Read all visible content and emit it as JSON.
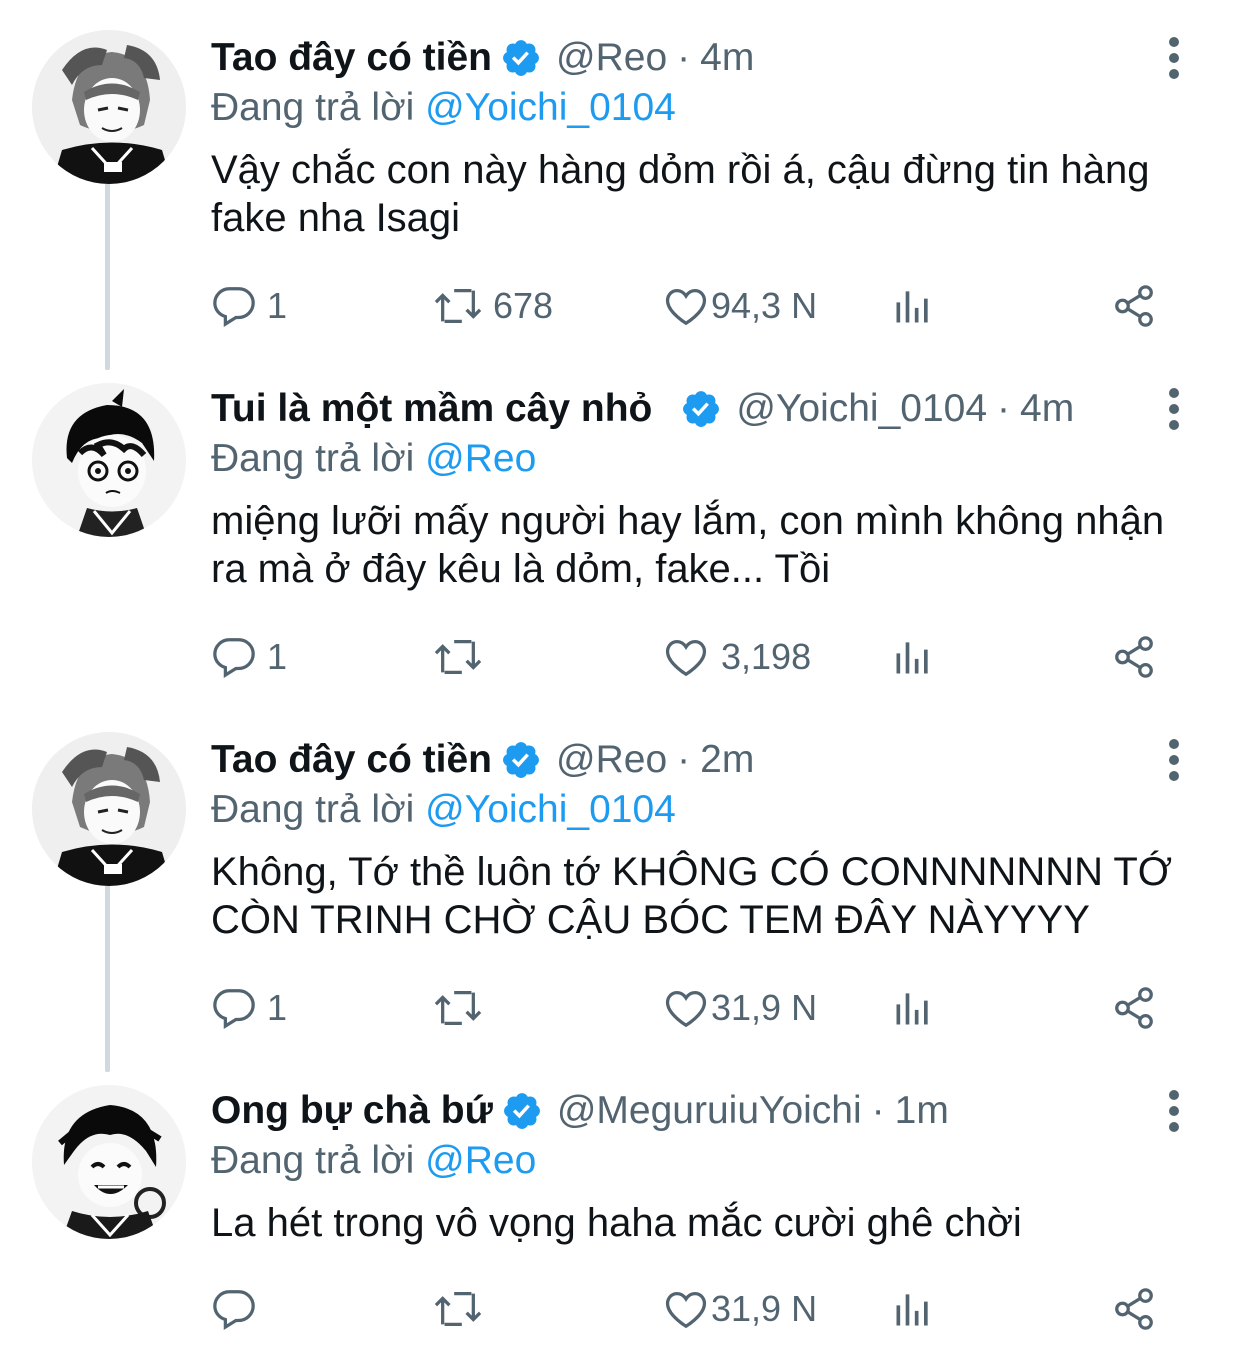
{
  "tweets": [
    {
      "display_name": "Tao đây có tiền",
      "handle": "@Reo",
      "separator": "·",
      "time": "4m",
      "reply_prefix": "Đang trả lời",
      "reply_to": "@Yoichi_0104",
      "text": "Vậy chắc con này hàng dỏm rồi á, cậu đừng tin hàng fake nha Isagi",
      "replies": "1",
      "retweets": "678",
      "likes": "94,3 N",
      "avatar": "reo-avatar"
    },
    {
      "display_name": "Tui là một mầm cây nhỏ",
      "handle": "@Yoichi_0104",
      "separator": "·",
      "time": "4m",
      "reply_prefix": "Đang trả lời",
      "reply_to": "@Reo",
      "text": "miệng lưỡi mấy người hay lắm, con mình không nhận ra mà ở đây kêu là dỏm, fake... Tồi",
      "replies": "1",
      "retweets": "",
      "likes": "3,198",
      "avatar": "isagi-avatar"
    },
    {
      "display_name": "Tao đây có tiền",
      "handle": "@Reo",
      "separator": "·",
      "time": "2m",
      "reply_prefix": "Đang trả lời",
      "reply_to": "@Yoichi_0104",
      "text": "Không, Tớ thề luôn tớ KHÔNG CÓ CONNNNNNN TỚ CÒN TRINH CHỜ CẬU BÓC TEM ĐÂY NÀYYYY",
      "replies": "1",
      "retweets": "",
      "likes": "31,9 N",
      "avatar": "reo-avatar"
    },
    {
      "display_name": "Ong bự chà bứ",
      "handle": "@MeguruiuYoichi",
      "separator": "·",
      "time": "1m",
      "reply_prefix": "Đang trả lời",
      "reply_to": "@Reo",
      "text": "La hét trong vô vọng haha mắc cười ghê chời",
      "replies": "",
      "retweets": "",
      "likes": "31,9 N",
      "avatar": "bachira-avatar"
    }
  ],
  "colors": {
    "accent": "#1d9bf0",
    "secondary_text": "#536471",
    "primary_text": "#0f1419",
    "thread_line": "#cfd9de"
  },
  "icons": [
    "reply-icon",
    "retweet-icon",
    "like-icon",
    "views-icon",
    "share-icon",
    "more-icon",
    "verified-badge-icon"
  ]
}
